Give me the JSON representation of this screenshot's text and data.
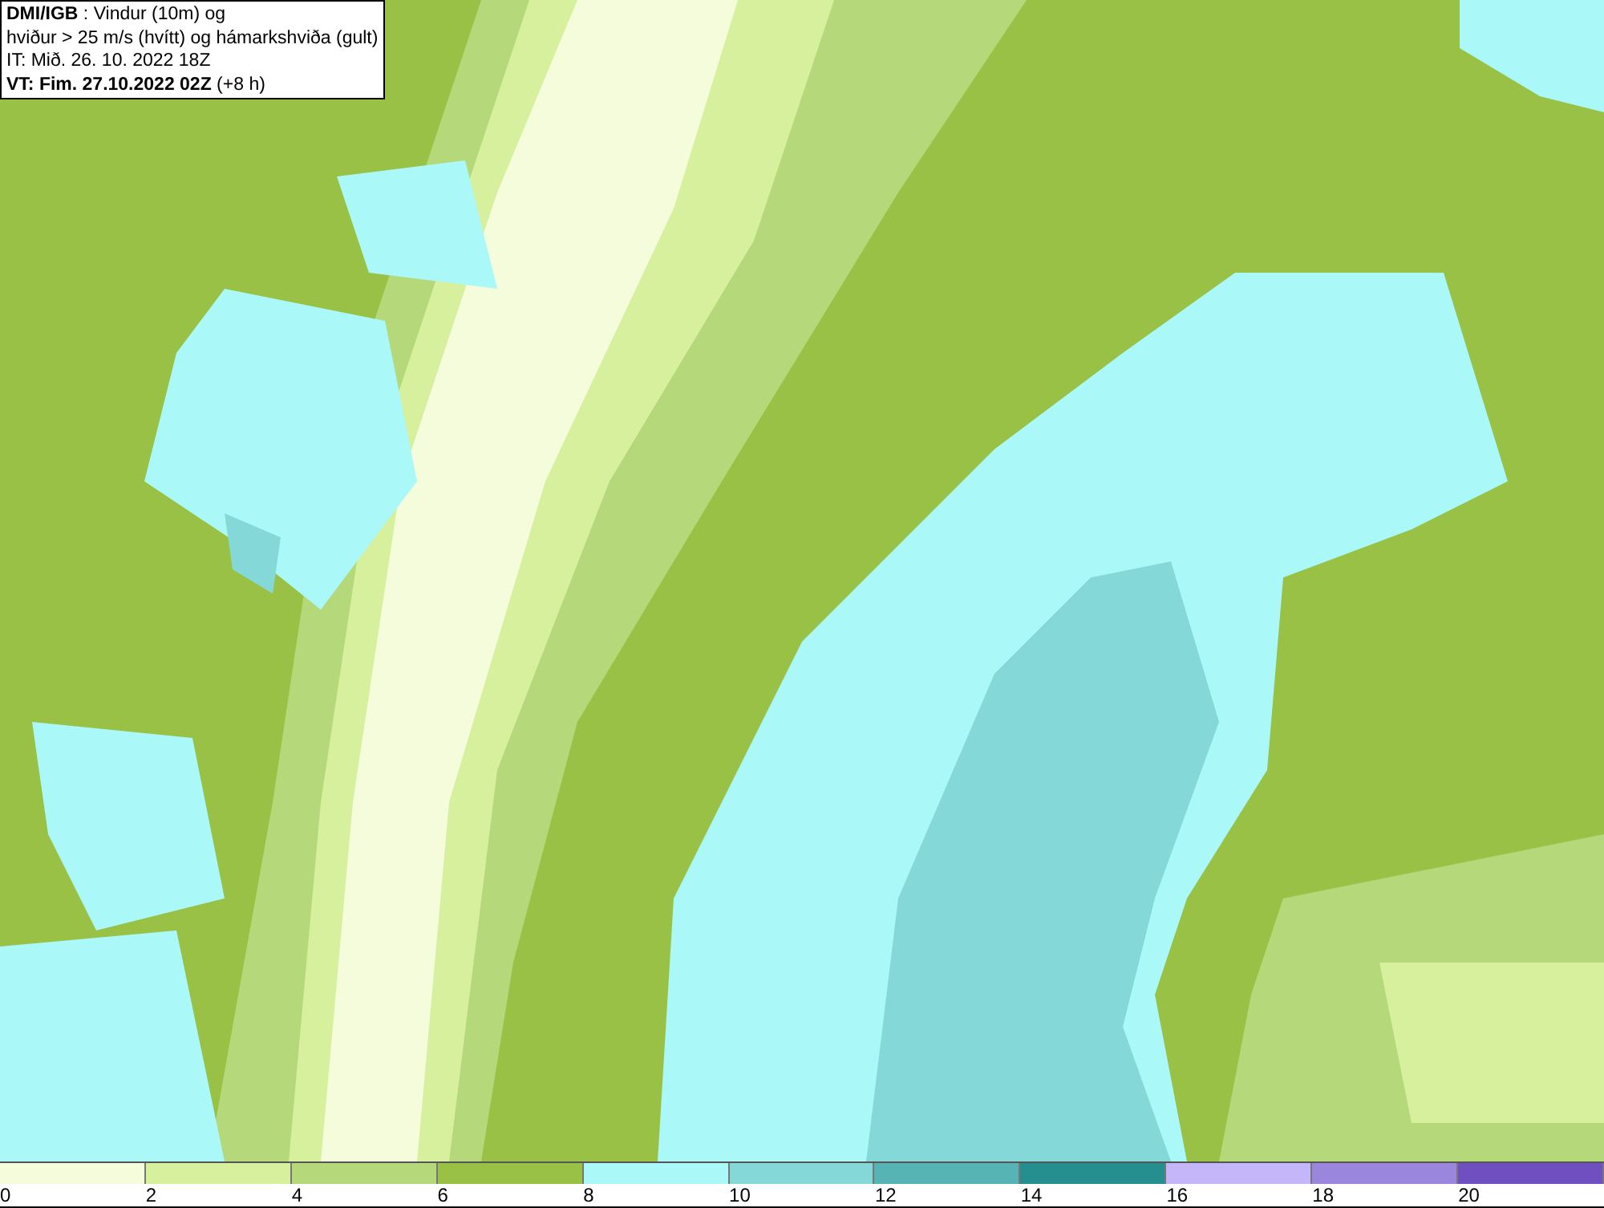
{
  "title_box": {
    "lines": [
      "**DMI/IGB** : Vindur (10m) og",
      "hviður > 25 m/s (hvítt) og hámarkshviða (gult)",
      "IT: Mið. 26. 10. 2022 18Z",
      "**VT: Fim. 27.10.2022 02Z** (+8 h)"
    ]
  },
  "legend": {
    "bins": [
      {
        "label": "0",
        "color": "#f5fcdc"
      },
      {
        "label": "2",
        "color": "#d7f09e"
      },
      {
        "label": "4",
        "color": "#b5d97a"
      },
      {
        "label": "6",
        "color": "#98c146"
      },
      {
        "label": "8",
        "color": "#aaf8f8"
      },
      {
        "label": "10",
        "color": "#84d8d8"
      },
      {
        "label": "12",
        "color": "#56b4b4"
      },
      {
        "label": "14",
        "color": "#258f8f"
      },
      {
        "label": "16",
        "color": "#c4b6f8"
      },
      {
        "label": "18",
        "color": "#9b86de"
      },
      {
        "label": "20",
        "color": "#7050c0"
      }
    ]
  }
}
